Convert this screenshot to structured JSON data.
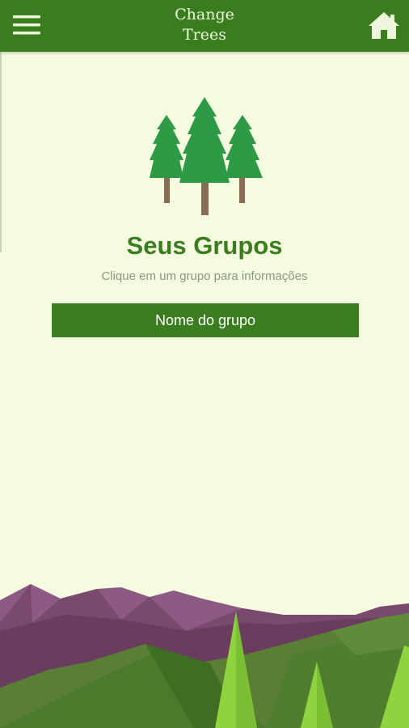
{
  "app_bar": {
    "title_line1": "Change",
    "title_line2": "Trees",
    "menu_icon": "hamburger-menu-icon",
    "home_icon": "home-icon"
  },
  "header": {
    "logo_icon": "trees-icon"
  },
  "main": {
    "title": "Seus Grupos",
    "subtitle": "Clique em um grupo para informações",
    "groups": [
      {
        "label": "Nome do grupo"
      }
    ]
  },
  "colors": {
    "primary_green": "#3a7d1f",
    "background": "#f5fbdf",
    "tree_green": "#2e9a46",
    "trunk_brown": "#8b6a55",
    "mountain_purple": "#7a4a6e",
    "hill_green": "#4f7f2e",
    "light_tree_green": "#8fd43e"
  }
}
